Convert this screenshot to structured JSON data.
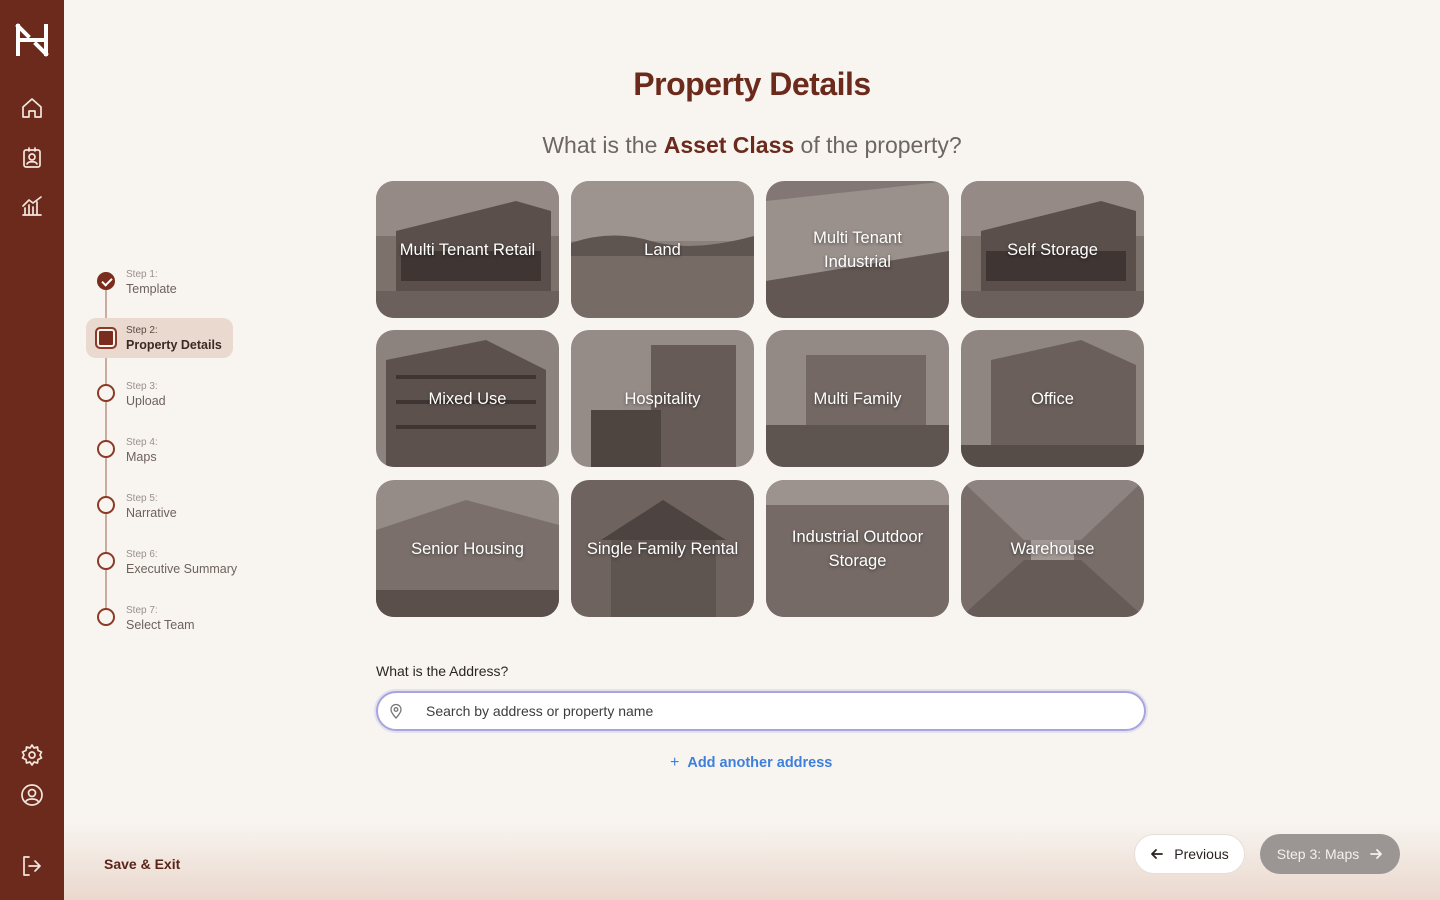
{
  "app": {
    "title": "Property Details",
    "brand_color": "#6b2a1c"
  },
  "sidebar": {
    "icons": [
      "logo-icon",
      "home-icon",
      "contacts-icon",
      "analytics-icon",
      "settings-icon",
      "profile-icon",
      "logout-icon"
    ]
  },
  "stepper": {
    "steps": [
      {
        "number": "Step 1:",
        "label": "Template",
        "state": "done"
      },
      {
        "number": "Step 2:",
        "label": "Property Details",
        "state": "active"
      },
      {
        "number": "Step 3:",
        "label": "Upload",
        "state": "pending"
      },
      {
        "number": "Step 4:",
        "label": "Maps",
        "state": "pending"
      },
      {
        "number": "Step 5:",
        "label": "Narrative",
        "state": "pending"
      },
      {
        "number": "Step 6:",
        "label": "Executive Summary",
        "state": "pending"
      },
      {
        "number": "Step 7:",
        "label": "Select Team",
        "state": "pending"
      }
    ],
    "save_exit": "Save & Exit"
  },
  "main": {
    "title": "Property Details",
    "question_pre": "What is the ",
    "question_highlight": "Asset Class",
    "question_post": " of the property?",
    "asset_classes": [
      {
        "label": "Multi Tenant Retail"
      },
      {
        "label": "Land"
      },
      {
        "label": "Multi Tenant Industrial"
      },
      {
        "label": "Self Storage"
      },
      {
        "label": "Mixed Use"
      },
      {
        "label": "Hospitality"
      },
      {
        "label": "Multi Family"
      },
      {
        "label": "Office"
      },
      {
        "label": "Senior Housing"
      },
      {
        "label": "Single Family Rental"
      },
      {
        "label": "Industrial Outdoor Storage"
      },
      {
        "label": "Warehouse"
      }
    ],
    "address_label": "What is the Address?",
    "address_placeholder": "Search by address or property name",
    "address_value": "",
    "add_address": "Add another address"
  },
  "footer": {
    "previous": "Previous",
    "next": "Step 3: Maps"
  }
}
